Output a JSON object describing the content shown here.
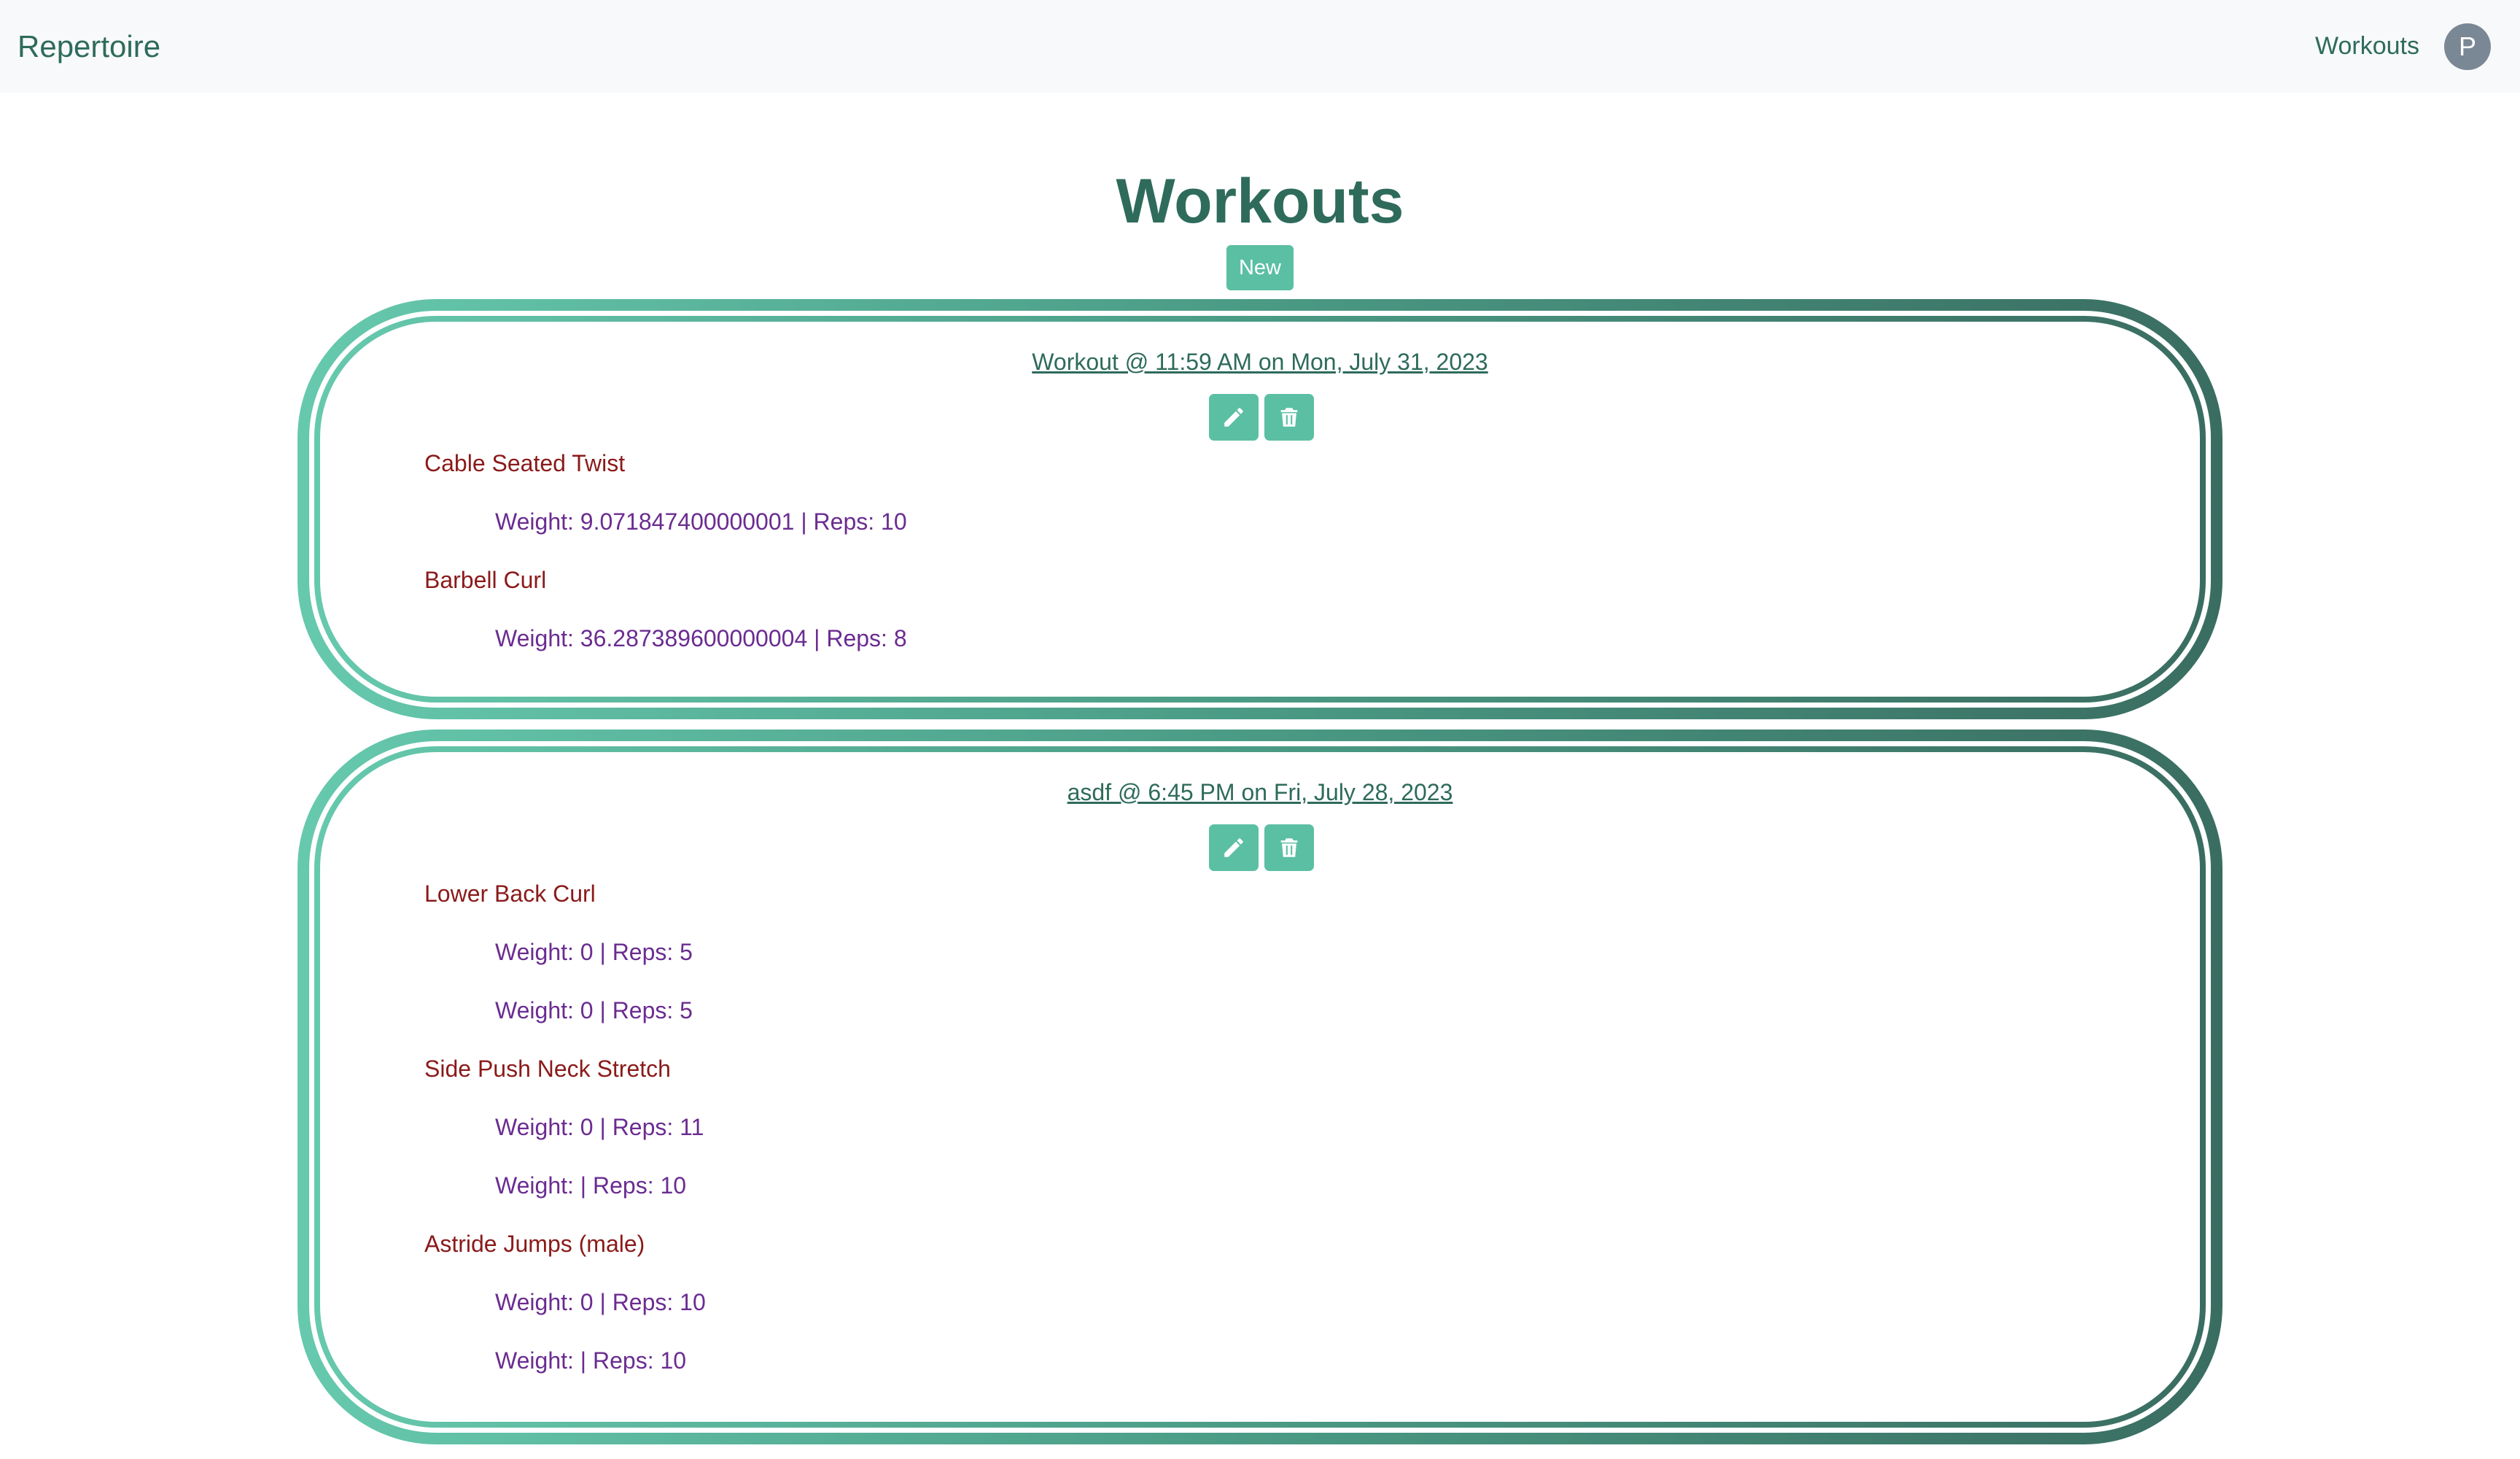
{
  "navbar": {
    "brand": "Repertoire",
    "workouts_link": "Workouts",
    "avatar_initial": "P"
  },
  "page": {
    "title": "Workouts",
    "new_button": "New"
  },
  "workouts": [
    {
      "title": "Workout @ 11:59 AM on Mon, July 31, 2023",
      "exercises": [
        {
          "name": "Cable Seated Twist",
          "sets": [
            "Weight: 9.071847400000001 | Reps: 10"
          ]
        },
        {
          "name": "Barbell Curl",
          "sets": [
            "Weight: 36.287389600000004 | Reps: 8"
          ]
        }
      ]
    },
    {
      "title": "asdf @ 6:45 PM on Fri, July 28, 2023",
      "exercises": [
        {
          "name": "Lower Back Curl",
          "sets": [
            "Weight: 0 | Reps: 5",
            "Weight: 0 | Reps: 5"
          ]
        },
        {
          "name": "Side Push Neck Stretch",
          "sets": [
            "Weight: 0 | Reps: 11",
            "Weight: | Reps: 10"
          ]
        },
        {
          "name": "Astride Jumps (male)",
          "sets": [
            "Weight: 0 | Reps: 10",
            "Weight: | Reps: 10"
          ]
        }
      ]
    }
  ],
  "icons": {
    "edit": "pencil-icon",
    "delete": "trash-icon"
  },
  "colors": {
    "accent": "#5bbfa3",
    "heading": "#2e6b5b",
    "exercise_name": "#8b1a1a",
    "set_text": "#6b2c91",
    "navbar_bg": "#f8f9fa"
  }
}
